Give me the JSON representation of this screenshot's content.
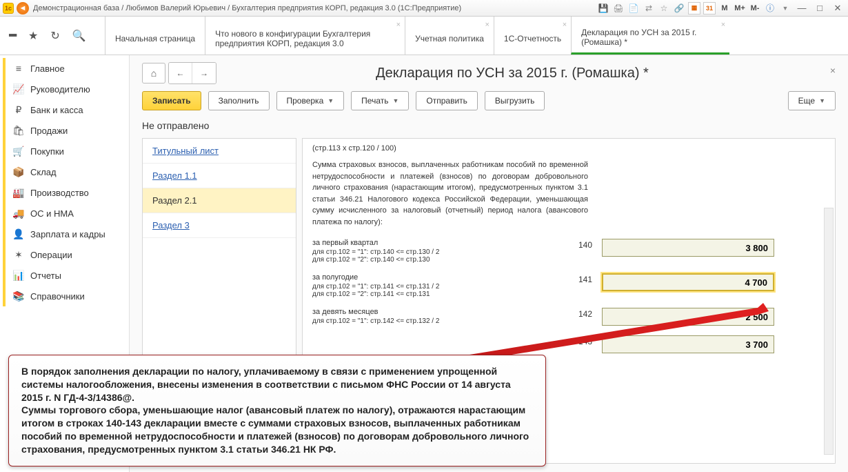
{
  "titlebar": {
    "text": "Демонстрационная база / Любимов Валерий Юрьевич / Бухгалтерия предприятия КОРП, редакция 3.0  (1С:Предприятие)",
    "m1": "M",
    "m2": "M+",
    "m3": "M-",
    "cal": "31"
  },
  "tabs": {
    "home": "Начальная страница",
    "whatsnew": "Что нового в конфигурации Бухгалтерия предприятия КОРП, редакция 3.0",
    "policy": "Учетная политика",
    "report": "1С-Отчетность",
    "decl": "Декларация по УСН за 2015 г. (Ромашка) *"
  },
  "sidebar": [
    {
      "icon": "≡",
      "label": "Главное"
    },
    {
      "icon": "📈",
      "label": "Руководителю"
    },
    {
      "icon": "₽",
      "label": "Банк и касса"
    },
    {
      "icon": "🛍",
      "label": "Продажи"
    },
    {
      "icon": "🛒",
      "label": "Покупки"
    },
    {
      "icon": "📦",
      "label": "Склад"
    },
    {
      "icon": "🏭",
      "label": "Производство"
    },
    {
      "icon": "🚚",
      "label": "ОС и НМА"
    },
    {
      "icon": "👤",
      "label": "Зарплата и кадры"
    },
    {
      "icon": "✶",
      "label": "Операции"
    },
    {
      "icon": "📊",
      "label": "Отчеты"
    },
    {
      "icon": "📚",
      "label": "Справочники"
    }
  ],
  "doc": {
    "title": "Декларация по УСН за 2015 г. (Ромашка) *",
    "save": "Записать",
    "fill": "Заполнить",
    "check": "Проверка",
    "print": "Печать",
    "send": "Отправить",
    "upload": "Выгрузить",
    "more": "Еще",
    "status": "Не отправлено"
  },
  "sections": [
    "Титульный лист",
    "Раздел 1.1",
    "Раздел 2.1",
    "Раздел 3"
  ],
  "form": {
    "topnote": "(стр.113 x стр.120 / 100)",
    "paragraph": "Сумма страховых взносов, выплаченных работникам пособий по временной нетрудоспособности и платежей (взносов) по договорам добровольного личного страхования (нарастающим итогом), предусмотренных пунктом 3.1 статьи 346.21 Налогового кодекса Российской Федерации, уменьшающая сумму исчисленного за налоговый (отчетный) период налога (авансового платежа по налогу):",
    "rows": [
      {
        "t1": "за первый квартал",
        "t2a": "для стр.102 = \"1\": стр.140 <= стр.130 / 2",
        "t2b": "для стр.102 = \"2\": стр.140 <= стр.130",
        "code": "140",
        "val": "3 800"
      },
      {
        "t1": "за полугодие",
        "t2a": "для стр.102 = \"1\": стр.141 <= стр.131 / 2",
        "t2b": "для стр.102 = \"2\": стр.141 <= стр.131",
        "code": "141",
        "val": "4 700"
      },
      {
        "t1": "за девять месяцев",
        "t2a": "для стр.102 = \"1\": стр.142 <= стр.132 / 2",
        "t2b": "",
        "code": "142",
        "val": "2 500"
      },
      {
        "t1": "",
        "t2a": "",
        "t2b": "",
        "code": "143",
        "val": "3 700"
      }
    ]
  },
  "callout": "В порядок заполнения декларации по налогу, уплачиваемому в связи с применением упрощенной системы налогообложения, внесены изменения в соответствии с письмом ФНС России от 14 августа 2015 г. N ГД-4-3/14386@.\nСуммы торгового сбора, уменьшающие налог (авансовый платеж по налогу), отражаются нарастающим итогом в строках 140-143 декларации вместе с суммами страховых взносов, выплаченных работникам пособий по временной нетрудоспособности и платежей (взносов) по договорам добровольного личного страхования, предусмотренных пунктом 3.1 статьи 346.21 НК РФ."
}
